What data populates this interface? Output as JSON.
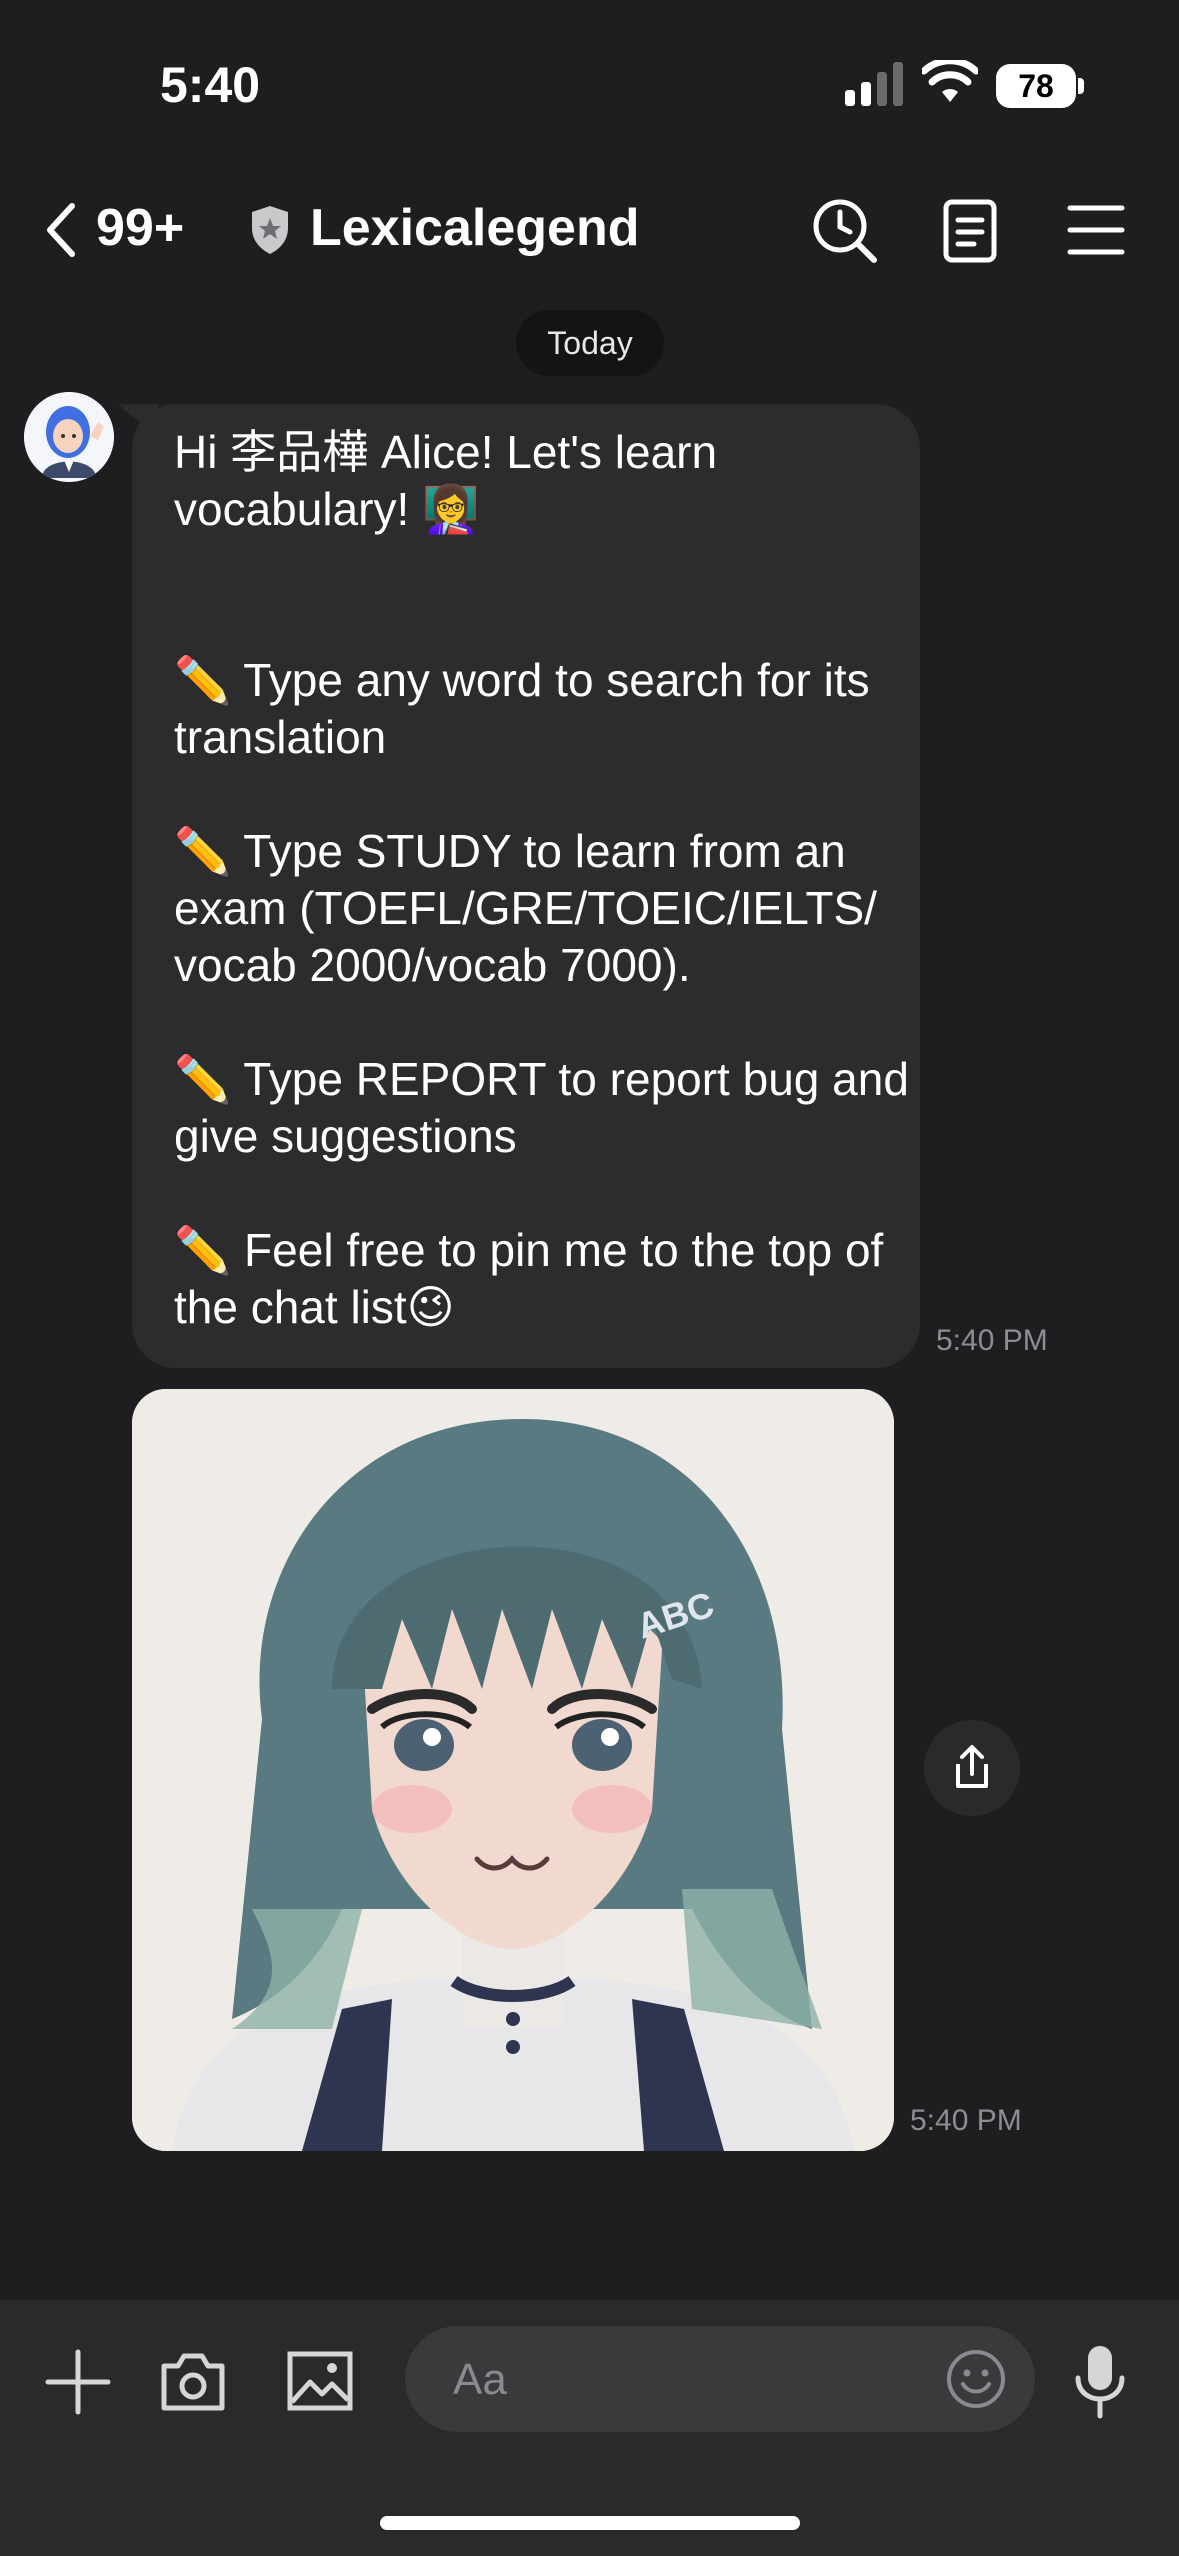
{
  "status_bar": {
    "time": "5:40",
    "battery": "78"
  },
  "header": {
    "unread_count": "99+",
    "title": "Lexicalegend"
  },
  "date_chip": "Today",
  "message": {
    "text": "Hi 李品樺 Alice! Let's learn vocabulary! 👩‍🏫\n\n\n✏️ Type any word to search for its translation\n\n✏️ Type STUDY to learn from an exam (TOEFL/GRE/TOEIC/IELTS/ vocab 2000/vocab 7000).\n\n✏️ Type REPORT to report bug and give suggestions\n\n✏️ Feel free to pin me to the top of the chat list😉",
    "timestamp": "5:40 PM"
  },
  "image_message": {
    "badge_text": "ABC",
    "timestamp": "5:40 PM"
  },
  "input": {
    "placeholder": "Aa"
  },
  "colors": {
    "background": "#1e1e20",
    "bubble": "#2c2c2e",
    "input_bar": "#2a2a2c",
    "hair": "#4f6b72"
  }
}
